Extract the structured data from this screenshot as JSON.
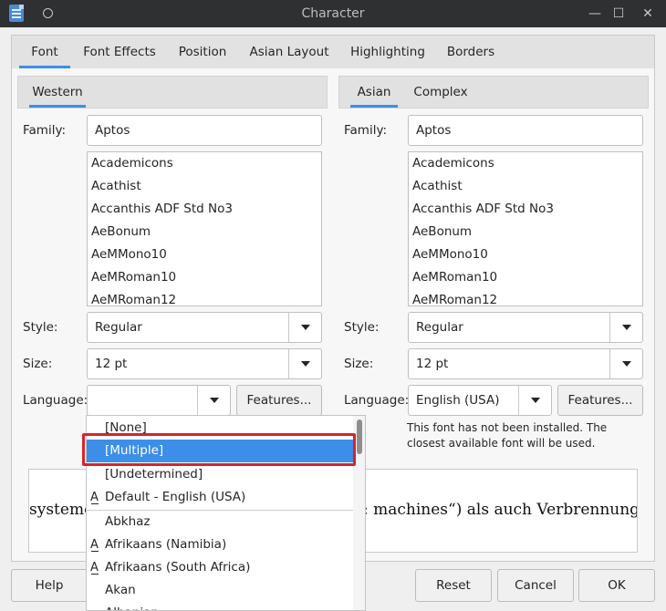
{
  "window": {
    "title": "Character",
    "minimize_glyph": "—",
    "maximize_glyph": "☐",
    "close_glyph": "✕"
  },
  "tabs": [
    "Font",
    "Font Effects",
    "Position",
    "Asian Layout",
    "Highlighting",
    "Borders"
  ],
  "western": {
    "subtab": "Western",
    "family_label": "Family:",
    "family_value": "Aptos",
    "font_list": [
      "Academicons",
      "Acathist",
      "Accanthis ADF Std No3",
      "AeBonum",
      "AeMMono10",
      "AeMRoman10",
      "AeMRoman12"
    ],
    "style_label": "Style:",
    "style_value": "Regular",
    "size_label": "Size:",
    "size_value": "12 pt",
    "language_label": "Language:",
    "language_value": "",
    "features_button": "Features..."
  },
  "asian": {
    "subtab": "Asian",
    "subtab2": "Complex",
    "family_label": "Family:",
    "family_value": "Aptos",
    "font_list": [
      "Academicons",
      "Acathist",
      "Accanthis ADF Std No3",
      "AeBonum",
      "AeMMono10",
      "AeMRoman10",
      "AeMRoman12"
    ],
    "style_label": "Style:",
    "style_value": "Regular",
    "size_label": "Size:",
    "size_value": "12 pt",
    "language_label": "Language:",
    "language_value": "English (USA)",
    "features_button": "Features...",
    "note": "This font has not been installed. The closest available font will be used."
  },
  "preview": {
    "text_left": "systeme,",
    "text_right": ": machines“) als auch Verbrennungsn"
  },
  "language_dropdown": {
    "items": [
      "[None]",
      "[Multiple]",
      "[Undetermined]",
      "Default - English (USA)",
      "Abkhaz",
      "Afrikaans (Namibia)",
      "Afrikaans (South Africa)",
      "Akan",
      "Albanian"
    ],
    "selected": "[Multiple]",
    "a_icon_glyph": "A"
  },
  "buttons": {
    "help": "Help",
    "reset": "Reset",
    "cancel": "Cancel",
    "ok": "OK"
  },
  "colors": {
    "accent": "#3d8ee8",
    "highlight_border": "#d8232a",
    "titlebar": "#2f3032"
  }
}
